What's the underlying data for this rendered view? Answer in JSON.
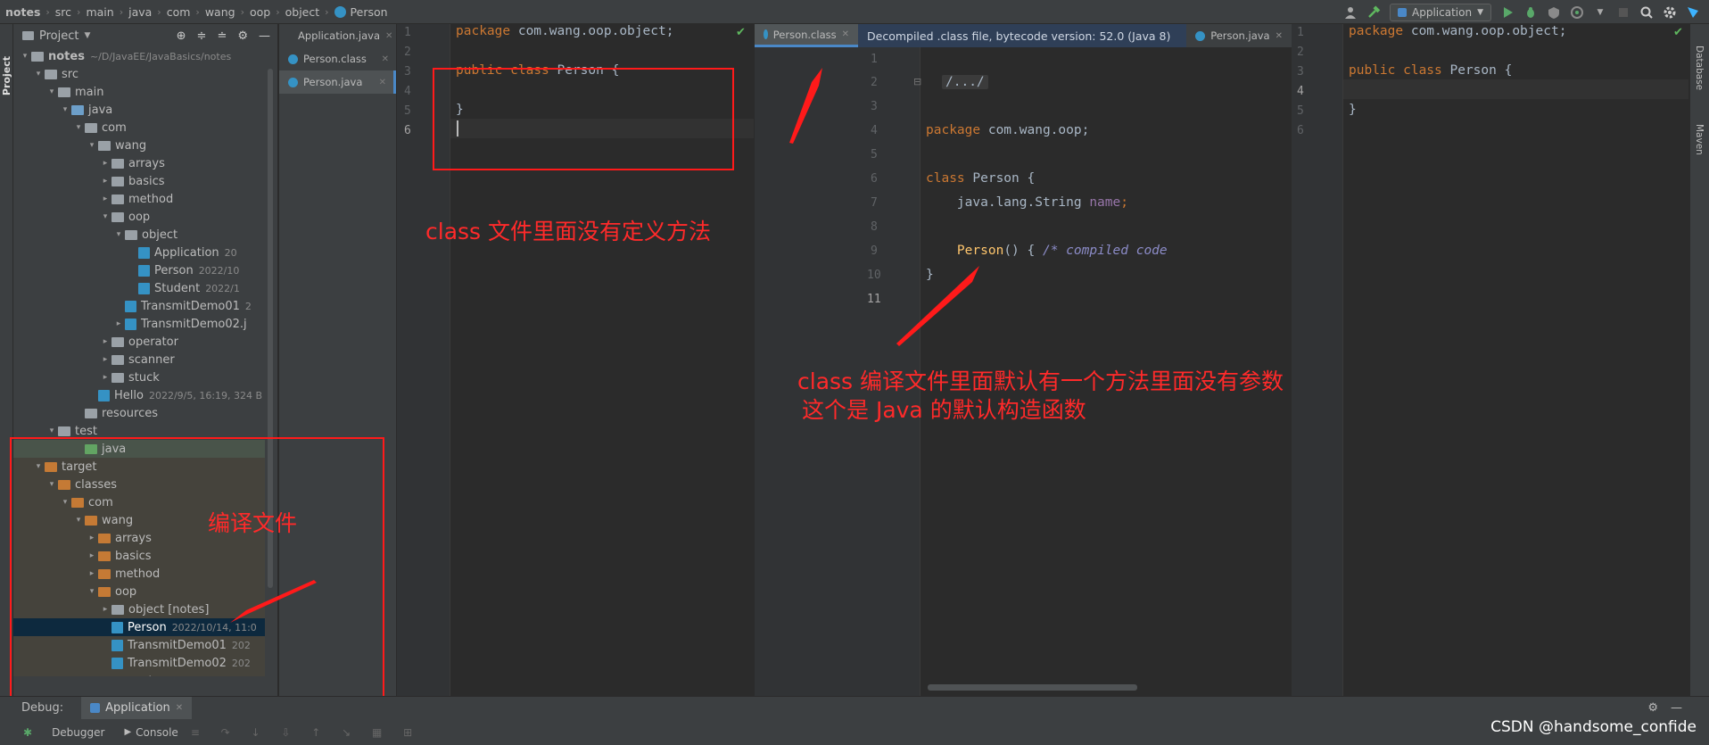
{
  "breadcrumbs": [
    "notes",
    "src",
    "main",
    "java",
    "com",
    "wang",
    "oop",
    "object",
    "Person"
  ],
  "run_config": "Application",
  "project_panel": {
    "title": "Project",
    "tree": [
      {
        "label": "notes",
        "meta": "~/D/JavaEE/JavaBasics/notes",
        "depth": 0,
        "kind": "root",
        "arrow": "down",
        "bold": true
      },
      {
        "label": "src",
        "depth": 1,
        "kind": "folder-gray",
        "arrow": "down"
      },
      {
        "label": "main",
        "depth": 2,
        "kind": "folder-gray",
        "arrow": "down"
      },
      {
        "label": "java",
        "depth": 3,
        "kind": "folder-blue",
        "arrow": "down"
      },
      {
        "label": "com",
        "depth": 4,
        "kind": "folder-gray",
        "arrow": "down"
      },
      {
        "label": "wang",
        "depth": 5,
        "kind": "folder-gray",
        "arrow": "down"
      },
      {
        "label": "arrays",
        "depth": 6,
        "kind": "folder-gray",
        "arrow": "right"
      },
      {
        "label": "basics",
        "depth": 6,
        "kind": "folder-gray",
        "arrow": "right"
      },
      {
        "label": "method",
        "depth": 6,
        "kind": "folder-gray",
        "arrow": "right"
      },
      {
        "label": "oop",
        "depth": 6,
        "kind": "folder-gray",
        "arrow": "down"
      },
      {
        "label": "object",
        "depth": 7,
        "kind": "folder-gray",
        "arrow": "down"
      },
      {
        "label": "Application",
        "meta": "20",
        "depth": 8,
        "kind": "class"
      },
      {
        "label": "Person",
        "meta": "2022/10",
        "depth": 8,
        "kind": "class"
      },
      {
        "label": "Student",
        "meta": "2022/1",
        "depth": 8,
        "kind": "class"
      },
      {
        "label": "TransmitDemo01",
        "meta": "2",
        "depth": 7,
        "kind": "class"
      },
      {
        "label": "TransmitDemo02.j",
        "depth": 7,
        "kind": "class",
        "arrow": "right"
      },
      {
        "label": "operator",
        "depth": 6,
        "kind": "folder-gray",
        "arrow": "right"
      },
      {
        "label": "scanner",
        "depth": 6,
        "kind": "folder-gray",
        "arrow": "right"
      },
      {
        "label": "stuck",
        "depth": 6,
        "kind": "folder-gray",
        "arrow": "right"
      },
      {
        "label": "Hello",
        "meta": "2022/9/5, 16:19, 324 B",
        "depth": 5,
        "kind": "class"
      },
      {
        "label": "resources",
        "depth": 4,
        "kind": "folder-gray"
      },
      {
        "label": "test",
        "depth": 2,
        "kind": "folder-gray",
        "arrow": "down"
      },
      {
        "label": "java",
        "depth": 4,
        "kind": "folder-green",
        "bg": "green"
      },
      {
        "label": "target",
        "depth": 1,
        "kind": "folder-orange",
        "arrow": "down",
        "bg": "brown"
      },
      {
        "label": "classes",
        "depth": 2,
        "kind": "folder-orange",
        "arrow": "down",
        "bg": "brown"
      },
      {
        "label": "com",
        "depth": 3,
        "kind": "folder-orange",
        "arrow": "down",
        "bg": "brown"
      },
      {
        "label": "wang",
        "depth": 4,
        "kind": "folder-orange",
        "arrow": "down",
        "bg": "brown"
      },
      {
        "label": "arrays",
        "depth": 5,
        "kind": "folder-orange",
        "arrow": "right",
        "bg": "brown"
      },
      {
        "label": "basics",
        "depth": 5,
        "kind": "folder-orange",
        "arrow": "right",
        "bg": "brown"
      },
      {
        "label": "method",
        "depth": 5,
        "kind": "folder-orange",
        "arrow": "right",
        "bg": "brown"
      },
      {
        "label": "oop",
        "depth": 5,
        "kind": "folder-orange",
        "arrow": "down",
        "bg": "brown"
      },
      {
        "label": "object [notes]",
        "depth": 6,
        "kind": "folder-gray",
        "arrow": "right",
        "bg": "brown"
      },
      {
        "label": "Person",
        "meta": "2022/10/14, 11:0",
        "depth": 6,
        "kind": "class",
        "selected": true
      },
      {
        "label": "TransmitDemo01",
        "meta": "202",
        "depth": 6,
        "kind": "class",
        "bg": "brown"
      },
      {
        "label": "TransmitDemo02",
        "meta": "202",
        "depth": 6,
        "kind": "class",
        "bg": "brown"
      },
      {
        "label": "operator",
        "depth": 5,
        "kind": "folder-orange",
        "arrow": "right",
        "bg": "brown"
      }
    ]
  },
  "open_files": [
    "Application.java",
    "Person.class",
    "Person.java"
  ],
  "editor_left": {
    "line_numbers": [
      "1",
      "2",
      "3",
      "4",
      "5",
      "6"
    ],
    "line1_kw": "package",
    "line1_rest": " com.wang.oop.object;",
    "line3_kw": "public class",
    "line3_rest": " Person {",
    "line5": "}"
  },
  "class_tabs": {
    "person_class": "Person.class",
    "banner": "Decompiled .class file, bytecode version: 52.0 (Java 8)",
    "person_java": "Person.java"
  },
  "editor_mid": {
    "line_numbers": [
      "1",
      "2",
      "3",
      "4",
      "5",
      "6",
      "7",
      "8",
      "9",
      "10",
      "11"
    ],
    "fold": "/.../",
    "line5_kw": "package",
    "line5_rest": " com.wang.oop;",
    "line7_kw": "class",
    "line7_rest": " Person {",
    "line8_type": "java.lang.String ",
    "line8_field": "name",
    "line8_end": ";",
    "line10_method": "Person",
    "line10_mid": "() { ",
    "line10_comment": "/* compiled code",
    "line11": "}"
  },
  "editor_right": {
    "line_numbers": [
      "1",
      "2",
      "3",
      "4",
      "5",
      "6"
    ],
    "line1_kw": "package",
    "line1_rest": " com.wang.oop.object;",
    "line3_kw": "public class",
    "line3_rest": " Person {",
    "line5": "}"
  },
  "annotations": {
    "no_method": "class 文件里面没有定义方法",
    "compiled_files": "编译文件",
    "default_ctor_1": "class 编译文件里面默认有一个方法里面没有参数",
    "default_ctor_2": "这个是 Java 的默认构造函数"
  },
  "debug": {
    "label": "Debug:",
    "tab": "Application"
  },
  "bottom_tools": {
    "debugger": "Debugger",
    "console": "Console"
  },
  "watermark": "CSDN @handsome_confide",
  "colors": {
    "annotation": "#ff1a1a",
    "keyword": "#cc7832",
    "method": "#ffc66d",
    "field": "#9876aa",
    "accent": "#4a88c7"
  }
}
